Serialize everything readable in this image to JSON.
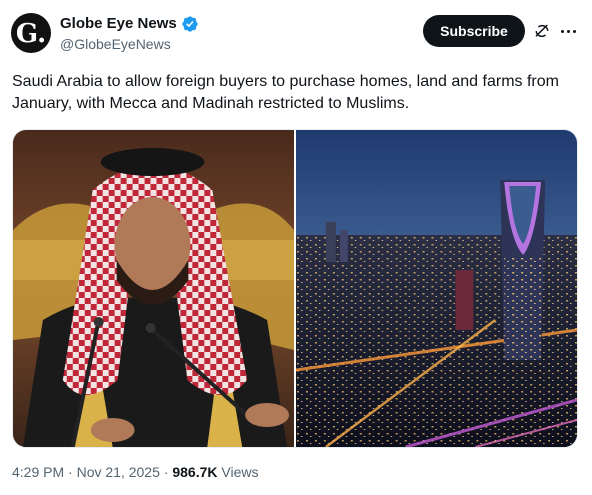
{
  "author": {
    "display_name": "Globe Eye News",
    "handle": "@GlobeEyeNews",
    "avatar_letter": "G.",
    "verified": true,
    "verified_color": "#1d9bf0"
  },
  "actions": {
    "subscribe_label": "Subscribe",
    "grok_icon": "grok-icon",
    "more_icon": "more-icon"
  },
  "tweet": {
    "text": "Saudi Arabia to allow foreign buyers to purchase homes, land and farms from January, with Mecca and Madinah restricted to Muslims."
  },
  "media": {
    "images": [
      {
        "name": "portrait-photo"
      },
      {
        "name": "riyadh-skyline-photo"
      }
    ]
  },
  "meta": {
    "time": "4:29 PM",
    "separator": " · ",
    "date": "Nov 21, 2025",
    "views_count": "986.7K",
    "views_label": " Views"
  },
  "colors": {
    "text_primary": "#0f1419",
    "text_secondary": "#536471",
    "button_bg": "#0f1419",
    "button_text": "#ffffff"
  }
}
